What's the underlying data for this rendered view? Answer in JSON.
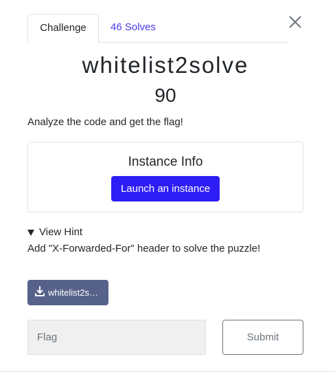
{
  "tabs": [
    {
      "label": "Challenge",
      "active": true
    },
    {
      "label": "46 Solves",
      "active": false
    }
  ],
  "close_icon": "close-icon",
  "challenge": {
    "name": "whitelist2solve",
    "points": "90",
    "description": "Analyze the code and get the flag!"
  },
  "instance": {
    "title": "Instance Info",
    "launch_label": "Launch an instance"
  },
  "hint": {
    "summary": "View Hint",
    "text": "Add \"X-Forwarded-For\" header to solve the puzzle!"
  },
  "file": {
    "label": "whitelist2s…",
    "icon": "download-icon"
  },
  "submission": {
    "flag_placeholder": "Flag",
    "flag_value": "",
    "submit_label": "Submit"
  },
  "colors": {
    "primary": "#2e1ef5",
    "link": "#4b39e6",
    "file_button": "#56628a"
  }
}
